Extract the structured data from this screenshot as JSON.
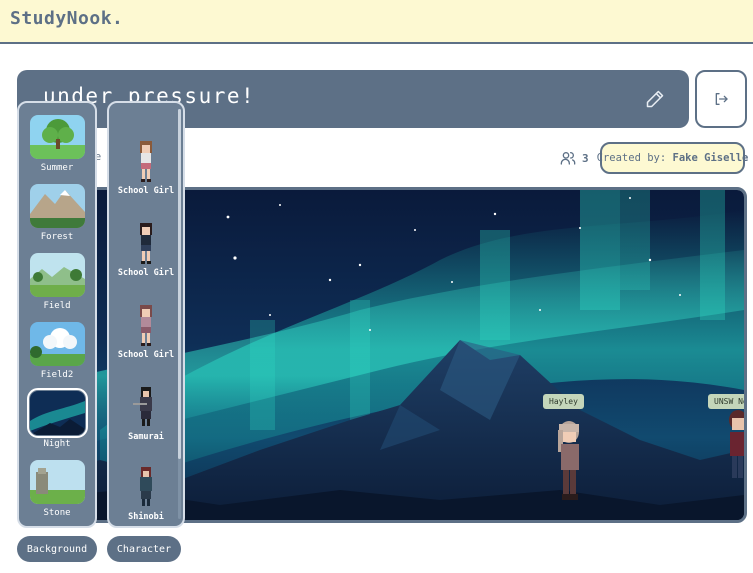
{
  "app": {
    "logo": "StudyNook."
  },
  "room": {
    "title": "under pressure!",
    "subtitle": "re      n on me",
    "member_count": "3",
    "created_by_label": "Created by:",
    "created_by_name": "Fake Giselle"
  },
  "scene": {
    "background": "Night",
    "players": [
      {
        "name": "Hayley"
      },
      {
        "name": "UNSW No"
      }
    ]
  },
  "backgrounds": {
    "items": [
      {
        "label": "Summer"
      },
      {
        "label": "Forest"
      },
      {
        "label": "Field"
      },
      {
        "label": "Field2"
      },
      {
        "label": "Night",
        "selected": true
      },
      {
        "label": "Stone"
      }
    ],
    "tab_label": "Background"
  },
  "characters": {
    "items": [
      {
        "label": "School Girl"
      },
      {
        "label": "School Girl"
      },
      {
        "label": "School Girl"
      },
      {
        "label": "Samurai"
      },
      {
        "label": "Shinobi"
      }
    ],
    "tab_label": "Character"
  },
  "colors": {
    "brand": "#5d7086",
    "header_bg": "#fdf9d2",
    "badge_bg": "#fdf9d2",
    "name_tag": "#c4d6ba"
  },
  "icons": {
    "edit": "pencil-icon",
    "leave": "logout-icon",
    "members": "users-icon"
  }
}
